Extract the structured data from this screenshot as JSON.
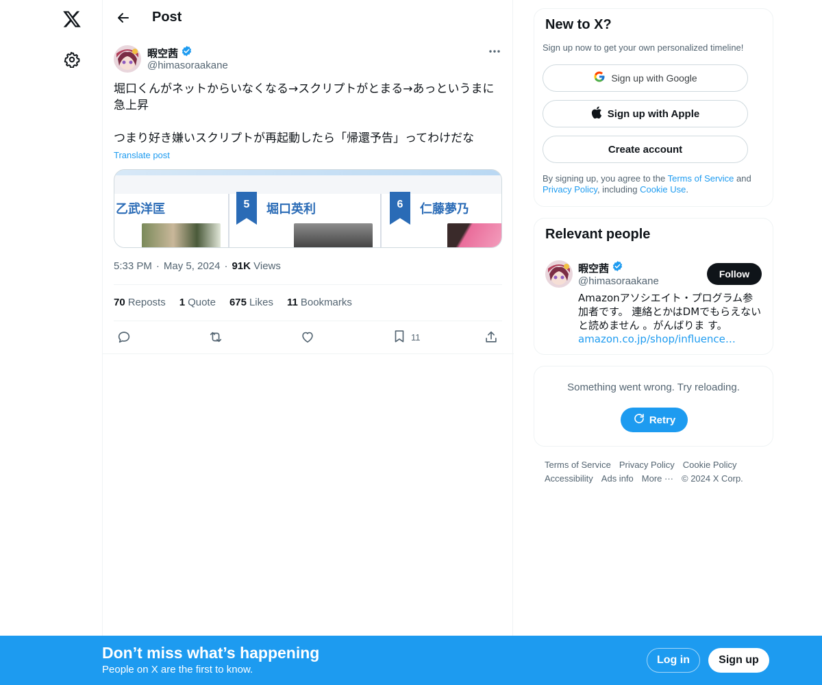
{
  "header": {
    "title": "Post"
  },
  "tweet": {
    "author_name": "暇空茜",
    "author_handle": "@himasoraakane",
    "text": "堀口くんがネットからいなくなる→スクリプトがとまる→あっというまに急上昇\n\nつまり好き嫌いスクリプトが再起動したら「帰還予告」ってわけだな",
    "translate_label": "Translate post",
    "media": {
      "candidates": [
        {
          "name": "乙武洋匡"
        },
        {
          "number": "5",
          "name": "堀口英利"
        },
        {
          "number": "6",
          "name": "仁藤夢乃"
        }
      ]
    },
    "time": "5:33 PM",
    "date": "May 5, 2024",
    "views_count": "91K",
    "views_label": "Views",
    "stats": {
      "reposts_count": "70",
      "reposts_label": "Reposts",
      "quotes_count": "1",
      "quotes_label": "Quote",
      "likes_count": "675",
      "likes_label": "Likes",
      "bookmarks_count": "11",
      "bookmarks_label": "Bookmarks"
    },
    "actions": {
      "bookmark_count": "11"
    }
  },
  "signup_card": {
    "title": "New to X?",
    "subtitle": "Sign up now to get your own personalized timeline!",
    "google_label": "Sign up with Google",
    "apple_label": "Sign up with Apple",
    "create_label": "Create account",
    "legal_prefix": "By signing up, you agree to the ",
    "terms_link": "Terms of Service",
    "legal_and": " and ",
    "privacy_link": "Privacy Policy",
    "legal_including": ", including ",
    "cookie_link": "Cookie Use",
    "legal_end": "."
  },
  "relevant_people": {
    "title": "Relevant people",
    "name": "暇空茜",
    "handle": "@himasoraakane",
    "follow_label": "Follow",
    "bio": "Amazonアソシエイト・プログラム参加者です。 連絡とかはDMでもらえないと読めません 。がんばりま す。",
    "bio_link": "amazon.co.jp/shop/influence…"
  },
  "error_card": {
    "message": "Something went wrong. Try reloading.",
    "retry_label": "Retry"
  },
  "footer": {
    "links": [
      "Terms of Service",
      "Privacy Policy",
      "Cookie Policy",
      "Accessibility",
      "Ads info",
      "More ···"
    ],
    "copyright": "© 2024 X Corp."
  },
  "banner": {
    "title": "Don’t miss what’s happening",
    "subtitle": "People on X are the first to know.",
    "login_label": "Log in",
    "signup_label": "Sign up"
  },
  "colors": {
    "accent": "#1d9bf0",
    "text_primary": "#0f1419",
    "text_secondary": "#536471",
    "border": "#eff3f4",
    "verified": "#1d9bf0"
  }
}
